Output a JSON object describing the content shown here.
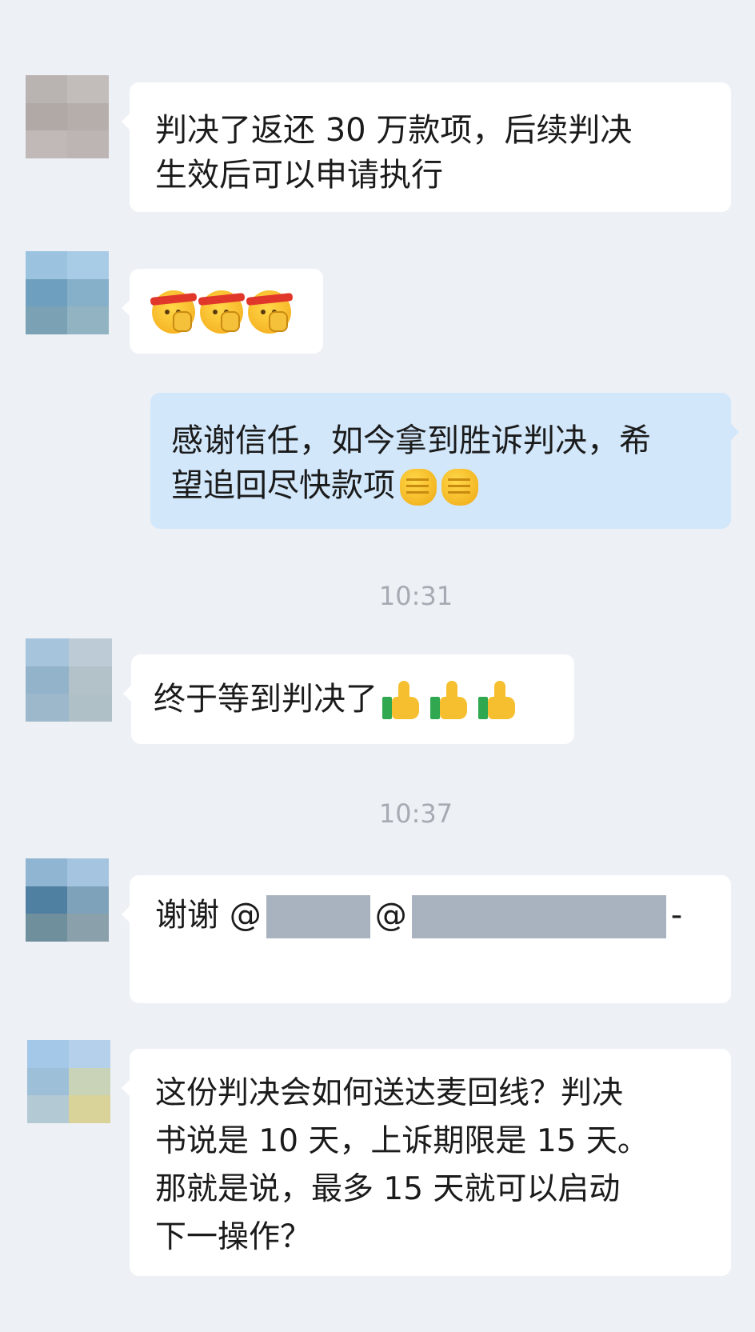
{
  "messages": [
    {
      "text": "判决了返还 30 万款项，后续判决生效后可以申请执行",
      "line1": "判决了返还 30 万款项，后续判决",
      "line2": "生效后可以申请执行"
    },
    {
      "emoji": "fighting-emoji"
    },
    {
      "line1": "感谢信任，如今拿到胜诉判决，希",
      "line2": "望追回尽快款项"
    },
    {
      "line1": "终于等到判决了"
    },
    {
      "prefix": "谢谢 @",
      "at": "@",
      "suffix": "-"
    },
    {
      "line1": "这份判决会如何送达麦回线？判决",
      "line2": "书说是 10 天，上诉期限是 15 天。",
      "line3": "那就是说，最多 15 天就可以启动",
      "line4": "下一操作？"
    }
  ],
  "timestamps": [
    "10:31",
    "10:37"
  ],
  "colors": {
    "background": "#edf0f5",
    "incoming_bubble": "#ffffff",
    "outgoing_bubble": "#d2e7fa",
    "timestamp": "#a6aab2",
    "redaction": "#a9b3bf"
  }
}
